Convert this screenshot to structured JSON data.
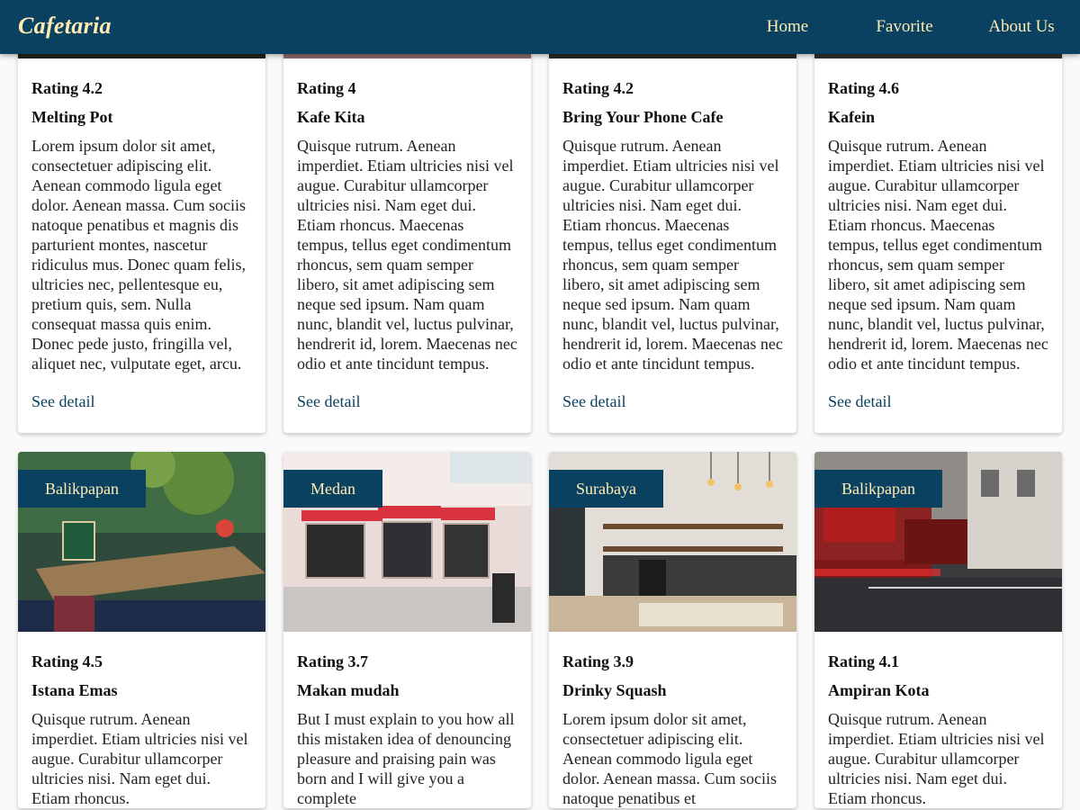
{
  "brand": "Cafetaria",
  "nav": [
    "Home",
    "Favorite",
    "About Us"
  ],
  "see_detail": "See detail",
  "colors": {
    "primary": "#0b4160",
    "accent_text": "#ffecb3"
  },
  "cards": [
    {
      "rating": "Rating 4.2",
      "name": "Melting Pot",
      "description": "Lorem ipsum dolor sit amet, consectetuer adipiscing elit. Aenean commodo ligula eget dolor. Aenean massa. Cum sociis natoque penatibus et magnis dis parturient montes, nascetur ridiculus mus. Donec quam felis, ultricies nec, pellentesque eu, pretium quis, sem. Nulla consequat massa quis enim. Donec pede justo, fringilla vel, aliquet nec, vulputate eget, arcu."
    },
    {
      "rating": "Rating 4",
      "name": "Kafe Kita",
      "description": "Quisque rutrum. Aenean imperdiet. Etiam ultricies nisi vel augue. Curabitur ullamcorper ultricies nisi. Nam eget dui. Etiam rhoncus. Maecenas tempus, tellus eget condimentum rhoncus, sem quam semper libero, sit amet adipiscing sem neque sed ipsum. Nam quam nunc, blandit vel, luctus pulvinar, hendrerit id, lorem. Maecenas nec odio et ante tincidunt tempus."
    },
    {
      "rating": "Rating 4.2",
      "name": "Bring Your Phone Cafe",
      "description": "Quisque rutrum. Aenean imperdiet. Etiam ultricies nisi vel augue. Curabitur ullamcorper ultricies nisi. Nam eget dui. Etiam rhoncus. Maecenas tempus, tellus eget condimentum rhoncus, sem quam semper libero, sit amet adipiscing sem neque sed ipsum. Nam quam nunc, blandit vel, luctus pulvinar, hendrerit id, lorem. Maecenas nec odio et ante tincidunt tempus."
    },
    {
      "rating": "Rating 4.6",
      "name": "Kafein",
      "description": "Quisque rutrum. Aenean imperdiet. Etiam ultricies nisi vel augue. Curabitur ullamcorper ultricies nisi. Nam eget dui. Etiam rhoncus. Maecenas tempus, tellus eget condimentum rhoncus, sem quam semper libero, sit amet adipiscing sem neque sed ipsum. Nam quam nunc, blandit vel, luctus pulvinar, hendrerit id, lorem. Maecenas nec odio et ante tincidunt tempus."
    },
    {
      "city": "Balikpapan",
      "rating": "Rating 4.5",
      "name": "Istana Emas",
      "description": "Quisque rutrum. Aenean imperdiet. Etiam ultricies nisi vel augue. Curabitur ullamcorper ultricies nisi. Nam eget dui. Etiam rhoncus."
    },
    {
      "city": "Medan",
      "rating": "Rating 3.7",
      "name": "Makan mudah",
      "description": "But I must explain to you how all this mistaken idea of denouncing pleasure and praising pain was born and I will give you a complete"
    },
    {
      "city": "Surabaya",
      "rating": "Rating 3.9",
      "name": "Drinky Squash",
      "description": "Lorem ipsum dolor sit amet, consectetuer adipiscing elit. Aenean commodo ligula eget dolor. Aenean massa. Cum sociis natoque penatibus et"
    },
    {
      "city": "Balikpapan",
      "rating": "Rating 4.1",
      "name": "Ampiran Kota",
      "description": "Quisque rutrum. Aenean imperdiet. Etiam ultricies nisi vel augue. Curabitur ullamcorper ultricies nisi. Nam eget dui. Etiam rhoncus."
    }
  ]
}
